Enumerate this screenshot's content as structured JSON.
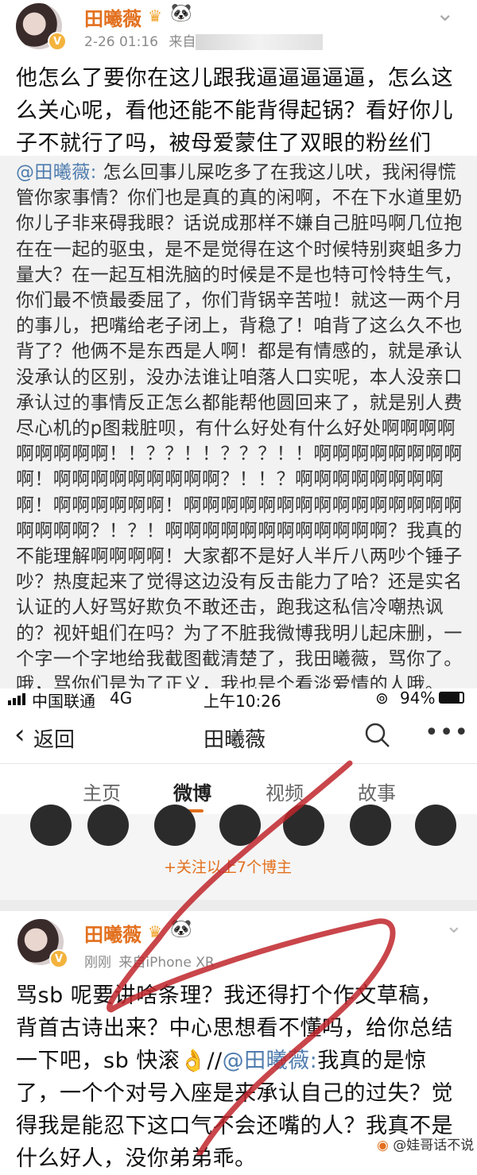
{
  "top_post": {
    "username": "田曦薇",
    "time": "2-26 01:16",
    "source_prefix": "来自",
    "text": "他怎么了要你在这儿跟我逼逼逼逼逼，怎么这么关心呢，看他还能不能背得起锅？看好你儿子不就行了吗，被母爱蒙住了双眼的粉丝们",
    "quote_mention": "@田曦薇:",
    "quote_text": " 怎么回事儿屎吃多了在我这儿吠，我闲得慌管你家事情？你们也是真的真的闲啊，不在下水道里奶你儿子非来碍我眼？话说成那样不嫌自己脏吗啊几位抱在在一起的驱虫，是不是觉得在这个时候特别爽蛆多力量大？在一起互相洗脑的时候是不是也特可怜特生气，你们最不愤最委屈了，你们背锅辛苦啦！就这一两个月的事儿，把嘴给老子闭上，背稳了！咱背了这么久不也背了？他俩不是东西是人啊！都是有情感的，就是承认没承认的区别，没办法谁让咱落人口实呢，本人没亲口承认过的事情反正怎么都能帮他圆回来了，就是别人费尽心机的p图栽脏呗，有什么好处有什么好处啊啊啊啊啊啊啊啊啊！！？？！！？？？！！啊啊啊啊啊啊啊啊啊！啊啊啊啊啊啊啊啊啊？！！？啊啊啊啊啊啊啊啊啊！啊啊啊啊啊啊！啊啊啊啊啊啊啊啊啊啊啊啊啊啊啊啊啊啊啊？！？！啊啊啊啊啊啊啊啊啊啊啊啊？我真的不能理解啊啊啊啊！大家都不是好人半斤八两吵个锤子吵？热度起来了觉得这边没有反击能力了哈？还是实名认证的人好骂好欺负不敢还击，跑我这私信冷嘲热讽的？视奸蛆们在吗？为了不脏我微博我明儿起床删，一个字一个字地给我截图截清楚了，我田曦薇，骂你了。哦，骂你们是为了正义，我也是个看淡爱情的人哦。"
  },
  "status_bar": {
    "carrier": "中国联通",
    "network": "4G",
    "time": "上午10:26",
    "battery": "94%"
  },
  "nav": {
    "back": "返回",
    "title": "田曦薇"
  },
  "tabs": [
    "主页",
    "微博",
    "视频",
    "故事"
  ],
  "follow_more": "+关注以上7个博主",
  "post2": {
    "username": "田曦薇",
    "time": "刚刚",
    "source": "来自iPhone XR",
    "text_a": "骂sb 呢要讲啥条理？我还得打个作文草稿，背首古诗出来？中心思想看不懂吗，给你总结一下吧，sb 快滚",
    "emoji": "👌",
    "sep": "//",
    "mention": "@田曦薇:",
    "text_b": "我真的是惊了，一个个对号入座是来承认自己的过失？觉得我是能忍下这口气不会还嘴的人？我真不是什么好人，没你弟弟乖。"
  },
  "watermark": "@娃哥话不说",
  "colors": {
    "accent": "#e2701e",
    "mention": "#4f7cae",
    "pen": "#c0262c"
  }
}
